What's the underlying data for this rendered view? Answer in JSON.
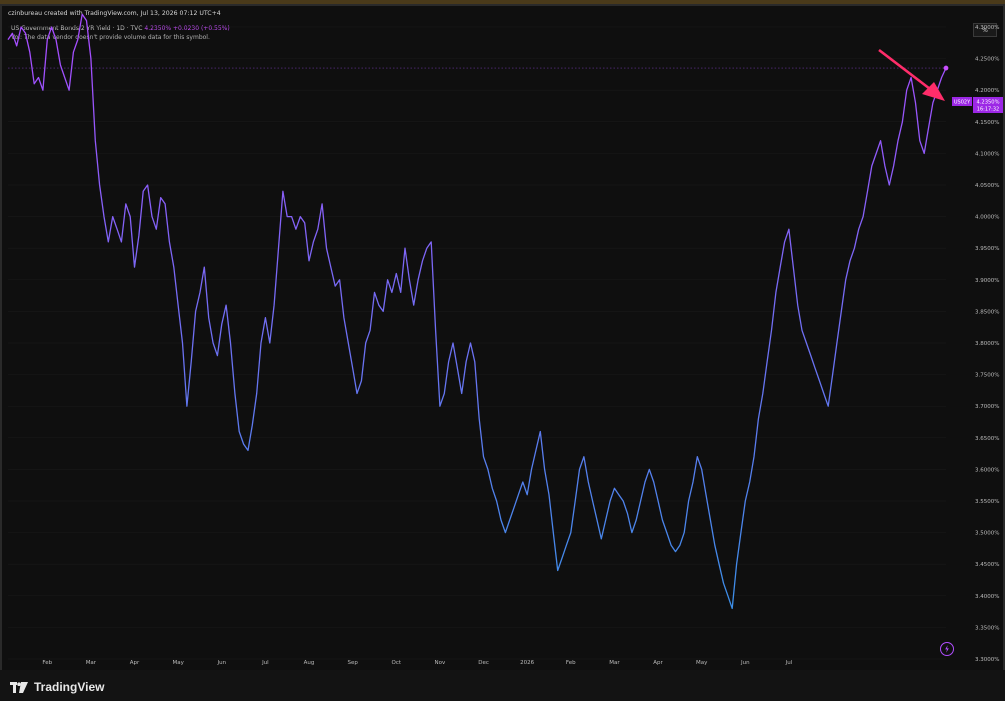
{
  "header": {
    "created_by": "czinbureau created with TradingView.com, Jul 13, 2026 07:12 UTC+4",
    "symbol_title": "US Government Bonds 2 YR Yield · 1D · TVC",
    "last_value": "4.2350%",
    "change": "+0.0230 (+0.55%)",
    "volume_note": "Vol: The data vendor doesn't provide volume data for this symbol."
  },
  "controls": {
    "percent_button": "%"
  },
  "price_tag": {
    "symbol": "US02Y",
    "value": "4.2350%",
    "countdown": "16:17:32"
  },
  "footer": {
    "logo_text": "TradingView"
  },
  "colors": {
    "line_top": "#a64dff",
    "line_bottom": "#3b8fe8",
    "tag_bg": "#9c27e6",
    "arrow": "#ff2d6a"
  },
  "icons": {
    "bolt": "lightning-bolt-icon",
    "logo": "tradingview-logo-icon",
    "arrow": "annotation-arrow-icon"
  },
  "chart_data": {
    "type": "line",
    "title": "US Government Bonds 2 YR Yield",
    "ylim": [
      3.3,
      4.33
    ],
    "y_ticks": [
      "4.3000%",
      "4.2500%",
      "4.2000%",
      "4.1500%",
      "4.1000%",
      "4.0500%",
      "4.0000%",
      "3.9500%",
      "3.9000%",
      "3.8500%",
      "3.8000%",
      "3.7500%",
      "3.7000%",
      "3.6500%",
      "3.6000%",
      "3.5500%",
      "3.5000%",
      "3.4500%",
      "3.4000%",
      "3.3500%",
      "3.3000%"
    ],
    "y_tick_values": [
      4.3,
      4.25,
      4.2,
      4.15,
      4.1,
      4.05,
      4.0,
      3.95,
      3.9,
      3.85,
      3.8,
      3.75,
      3.7,
      3.65,
      3.6,
      3.55,
      3.5,
      3.45,
      3.4,
      3.35,
      3.3
    ],
    "x_ticks": [
      "Feb",
      "Mar",
      "Apr",
      "May",
      "Jun",
      "Jul",
      "Aug",
      "Sep",
      "Oct",
      "Nov",
      "Dec",
      "2026",
      "Feb",
      "Mar",
      "Apr",
      "May",
      "Jun",
      "Jul"
    ],
    "x_tick_index": [
      9,
      19,
      29,
      39,
      49,
      59,
      69,
      79,
      89,
      99,
      109,
      119,
      129,
      139,
      149,
      159,
      169,
      179
    ],
    "series": [
      {
        "values": [
          4.28,
          4.29,
          4.27,
          4.3,
          4.29,
          4.26,
          4.21,
          4.22,
          4.2,
          4.28,
          4.3,
          4.28,
          4.24,
          4.22,
          4.2,
          4.26,
          4.28,
          4.32,
          4.31,
          4.25,
          4.12,
          4.05,
          4.0,
          3.96,
          4.0,
          3.98,
          3.96,
          4.02,
          4.0,
          3.92,
          3.97,
          4.04,
          4.05,
          4.0,
          3.98,
          4.03,
          4.02,
          3.96,
          3.92,
          3.86,
          3.8,
          3.7,
          3.77,
          3.85,
          3.88,
          3.92,
          3.84,
          3.8,
          3.78,
          3.83,
          3.86,
          3.8,
          3.72,
          3.66,
          3.64,
          3.63,
          3.67,
          3.72,
          3.8,
          3.84,
          3.8,
          3.86,
          3.95,
          4.04,
          4.0,
          4.0,
          3.98,
          4.0,
          3.99,
          3.93,
          3.96,
          3.98,
          4.02,
          3.95,
          3.92,
          3.89,
          3.9,
          3.84,
          3.8,
          3.76,
          3.72,
          3.74,
          3.8,
          3.82,
          3.88,
          3.86,
          3.85,
          3.9,
          3.88,
          3.91,
          3.88,
          3.95,
          3.9,
          3.86,
          3.9,
          3.93,
          3.95,
          3.96,
          3.82,
          3.7,
          3.72,
          3.77,
          3.8,
          3.76,
          3.72,
          3.77,
          3.8,
          3.77,
          3.68,
          3.62,
          3.6,
          3.57,
          3.55,
          3.52,
          3.5,
          3.52,
          3.54,
          3.56,
          3.58,
          3.56,
          3.6,
          3.63,
          3.66,
          3.6,
          3.56,
          3.5,
          3.44,
          3.46,
          3.48,
          3.5,
          3.55,
          3.6,
          3.62,
          3.58,
          3.55,
          3.52,
          3.49,
          3.52,
          3.55,
          3.57,
          3.56,
          3.55,
          3.53,
          3.5,
          3.52,
          3.55,
          3.58,
          3.6,
          3.58,
          3.55,
          3.52,
          3.5,
          3.48,
          3.47,
          3.48,
          3.5,
          3.55,
          3.58,
          3.62,
          3.6,
          3.56,
          3.52,
          3.48,
          3.45,
          3.42,
          3.4,
          3.38,
          3.45,
          3.5,
          3.55,
          3.58,
          3.62,
          3.68,
          3.72,
          3.77,
          3.82,
          3.88,
          3.92,
          3.96,
          3.98,
          3.92,
          3.86,
          3.82,
          3.8,
          3.78,
          3.76,
          3.74,
          3.72,
          3.7,
          3.75,
          3.8,
          3.85,
          3.9,
          3.93,
          3.95,
          3.98,
          4.0,
          4.04,
          4.08,
          4.1,
          4.12,
          4.08,
          4.05,
          4.08,
          4.12,
          4.15,
          4.2,
          4.22,
          4.18,
          4.12,
          4.1,
          4.14,
          4.18,
          4.2,
          4.22,
          4.235
        ]
      }
    ]
  }
}
